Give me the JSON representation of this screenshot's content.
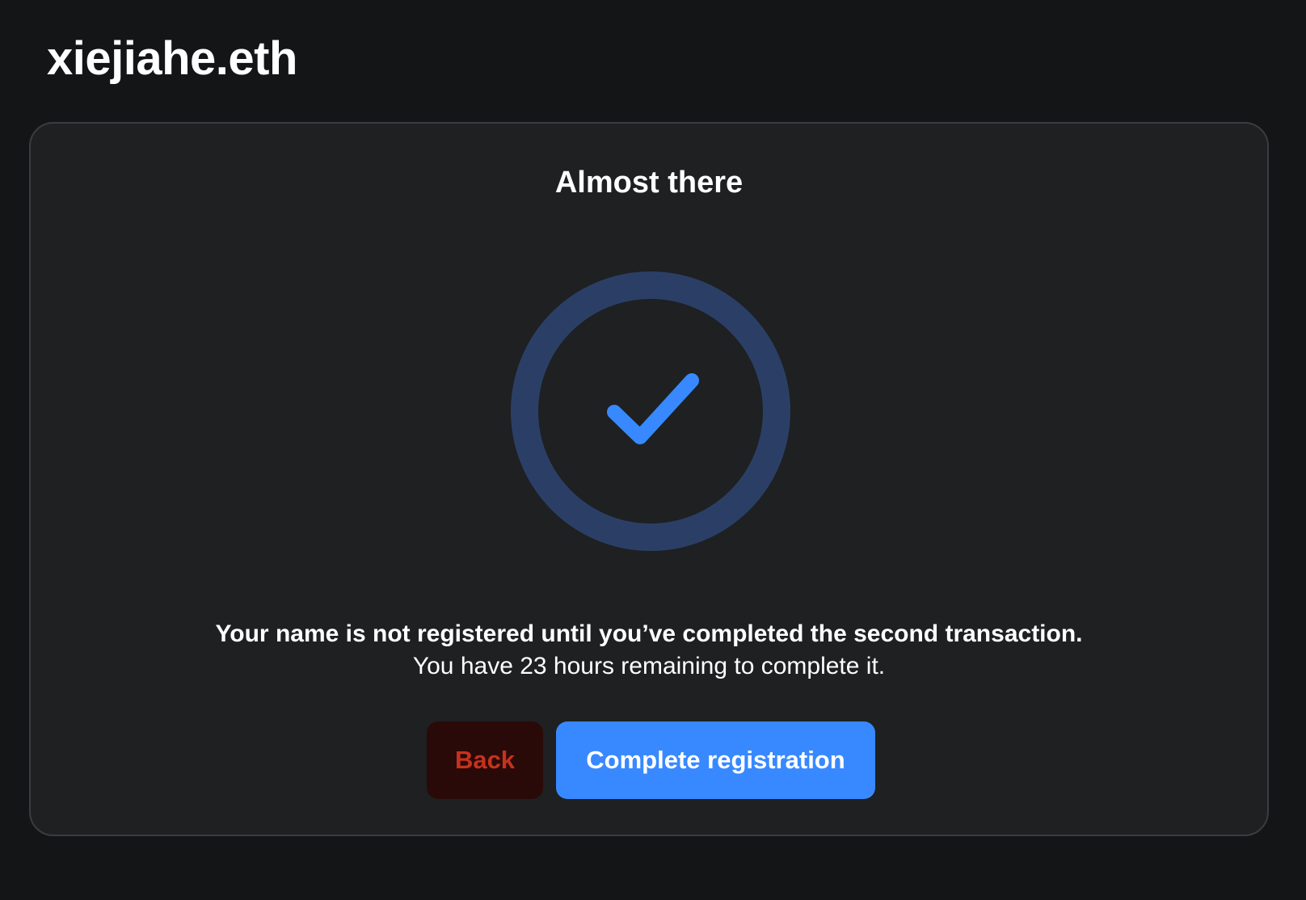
{
  "header": {
    "name": "xiejiahe.eth"
  },
  "card": {
    "title": "Almost there",
    "status_icon": "check-circle-icon",
    "message_line1": "Your name is not registered until you’ve completed the second transaction.",
    "message_line2": "You have 23 hours remaining to complete it.",
    "back_label": "Back",
    "primary_label": "Complete registration"
  },
  "colors": {
    "background": "#141517",
    "card": "#1e2022",
    "accent": "#3889ff",
    "ring": "#2b3f66",
    "danger_text": "#c6321e",
    "danger_bg": "#2a0a08"
  }
}
